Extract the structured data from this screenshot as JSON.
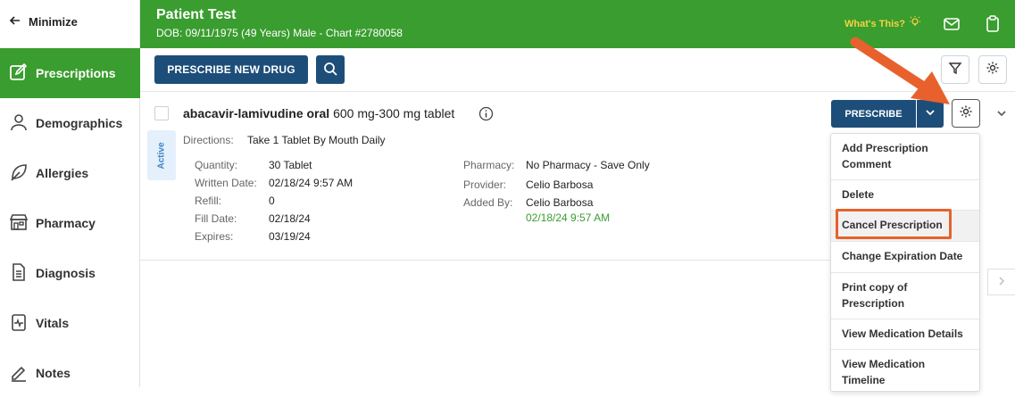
{
  "sidebar": {
    "minimize_label": "Minimize",
    "items": [
      {
        "label": "Prescriptions",
        "icon": "edit-square-icon",
        "active": true
      },
      {
        "label": "Demographics",
        "icon": "person-icon"
      },
      {
        "label": "Allergies",
        "icon": "leaf-icon"
      },
      {
        "label": "Pharmacy",
        "icon": "store-icon"
      },
      {
        "label": "Diagnosis",
        "icon": "document-icon"
      },
      {
        "label": "Vitals",
        "icon": "clipboard-pulse-icon"
      },
      {
        "label": "Notes",
        "icon": "pencil-icon"
      }
    ]
  },
  "header": {
    "patient_name": "Patient Test",
    "patient_meta": "DOB: 09/11/1975 (49 Years) Male - Chart #2780058",
    "whats_this": "What's This?",
    "bg_color": "#3a9d2f"
  },
  "toolbar": {
    "prescribe_new_label": "PRESCRIBE NEW DRUG"
  },
  "prescription": {
    "status": "Active",
    "drug_name": "abacavir-lamivudine oral",
    "strength": " 600 mg-300 mg tablet",
    "directions_label": "Directions:",
    "directions_value": "Take 1 Tablet By Mouth Daily",
    "quantity_label": "Quantity:",
    "quantity_value": "30 Tablet",
    "written_label": "Written Date:",
    "written_value": "02/18/24 9:57 AM",
    "refill_label": "Refill:",
    "refill_value": "0",
    "fill_label": "Fill Date:",
    "fill_value": "02/18/24",
    "expires_label": "Expires:",
    "expires_value": "03/19/24",
    "pharmacy_label": "Pharmacy:",
    "pharmacy_value": "No Pharmacy - Save Only",
    "provider_label": "Provider:",
    "provider_value": "Celio Barbosa",
    "added_label": "Added By:",
    "added_value": "Celio Barbosa",
    "added_date": "02/18/24 9:57 AM",
    "prescribe_label": "PRESCRIBE"
  },
  "menu": {
    "items": [
      "Add Prescription Comment",
      "Delete",
      "Cancel Prescription",
      "Change Expiration Date",
      "Print copy of Prescription",
      "View Medication Details",
      "View Medication Timeline"
    ]
  },
  "colors": {
    "accent_green": "#3a9d2f",
    "navy": "#1d4e79",
    "callout_orange": "#e8612c"
  }
}
